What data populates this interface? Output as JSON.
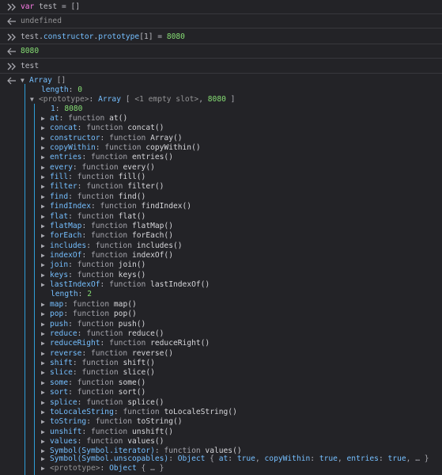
{
  "history": {
    "cmd1": {
      "prefix": "var",
      "ident": "test",
      "rest": " = []"
    },
    "result1": "undefined",
    "cmd2": {
      "obj": "test",
      "dot1": ".",
      "p1": "constructor",
      "dot2": ".",
      "p2": "prototype",
      "rest": "[1] = ",
      "val": "8080"
    },
    "result2": "8080",
    "cmd3": "test"
  },
  "tree": {
    "root": {
      "name": "Array",
      "suffix": " []"
    },
    "length_row": {
      "key": "length",
      "sep": ": ",
      "val": "0"
    },
    "proto": {
      "key": "<prototype>",
      "sep": ": ",
      "type": "Array",
      "open": " [ ",
      "empty": "<1 empty slot>",
      "comma": ", ",
      "val": "8080",
      "close": " ]"
    },
    "index_row": {
      "key": "1",
      "sep": ": ",
      "val": "8080"
    },
    "methods_a": [
      {
        "key": "at",
        "fn": "at()"
      },
      {
        "key": "concat",
        "fn": "concat()"
      },
      {
        "key": "constructor",
        "fn": "Array()"
      },
      {
        "key": "copyWithin",
        "fn": "copyWithin()"
      },
      {
        "key": "entries",
        "fn": "entries()"
      },
      {
        "key": "every",
        "fn": "every()"
      },
      {
        "key": "fill",
        "fn": "fill()"
      },
      {
        "key": "filter",
        "fn": "filter()"
      },
      {
        "key": "find",
        "fn": "find()"
      },
      {
        "key": "findIndex",
        "fn": "findIndex()"
      },
      {
        "key": "flat",
        "fn": "flat()"
      },
      {
        "key": "flatMap",
        "fn": "flatMap()"
      },
      {
        "key": "forEach",
        "fn": "forEach()"
      },
      {
        "key": "includes",
        "fn": "includes()"
      },
      {
        "key": "indexOf",
        "fn": "indexOf()"
      },
      {
        "key": "join",
        "fn": "join()"
      },
      {
        "key": "keys",
        "fn": "keys()"
      },
      {
        "key": "lastIndexOf",
        "fn": "lastIndexOf()"
      }
    ],
    "proto_length": {
      "key": "length",
      "sep": ": ",
      "val": "2"
    },
    "methods_b": [
      {
        "key": "map",
        "fn": "map()"
      },
      {
        "key": "pop",
        "fn": "pop()"
      },
      {
        "key": "push",
        "fn": "push()"
      },
      {
        "key": "reduce",
        "fn": "reduce()"
      },
      {
        "key": "reduceRight",
        "fn": "reduceRight()"
      },
      {
        "key": "reverse",
        "fn": "reverse()"
      },
      {
        "key": "shift",
        "fn": "shift()"
      },
      {
        "key": "slice",
        "fn": "slice()"
      },
      {
        "key": "some",
        "fn": "some()"
      },
      {
        "key": "sort",
        "fn": "sort()"
      },
      {
        "key": "splice",
        "fn": "splice()"
      },
      {
        "key": "toLocaleString",
        "fn": "toLocaleString()"
      },
      {
        "key": "toString",
        "fn": "toString()"
      },
      {
        "key": "unshift",
        "fn": "unshift()"
      },
      {
        "key": "values",
        "fn": "values()"
      },
      {
        "key": "Symbol(Symbol.iterator)",
        "fn": "values()"
      }
    ],
    "function_word": "function",
    "unscopables": {
      "key": "Symbol(Symbol.unscopables)",
      "sep": ": ",
      "type": "Object",
      "open": " { ",
      "k1": "at",
      "v1": "true",
      "k2": "copyWithin",
      "v2": "true",
      "k3": "entries",
      "v3": "true",
      "tail": ", … }"
    },
    "inner_proto": {
      "key": "<prototype>",
      "sep": ": ",
      "type": "Object",
      "tail": " { … }"
    }
  }
}
